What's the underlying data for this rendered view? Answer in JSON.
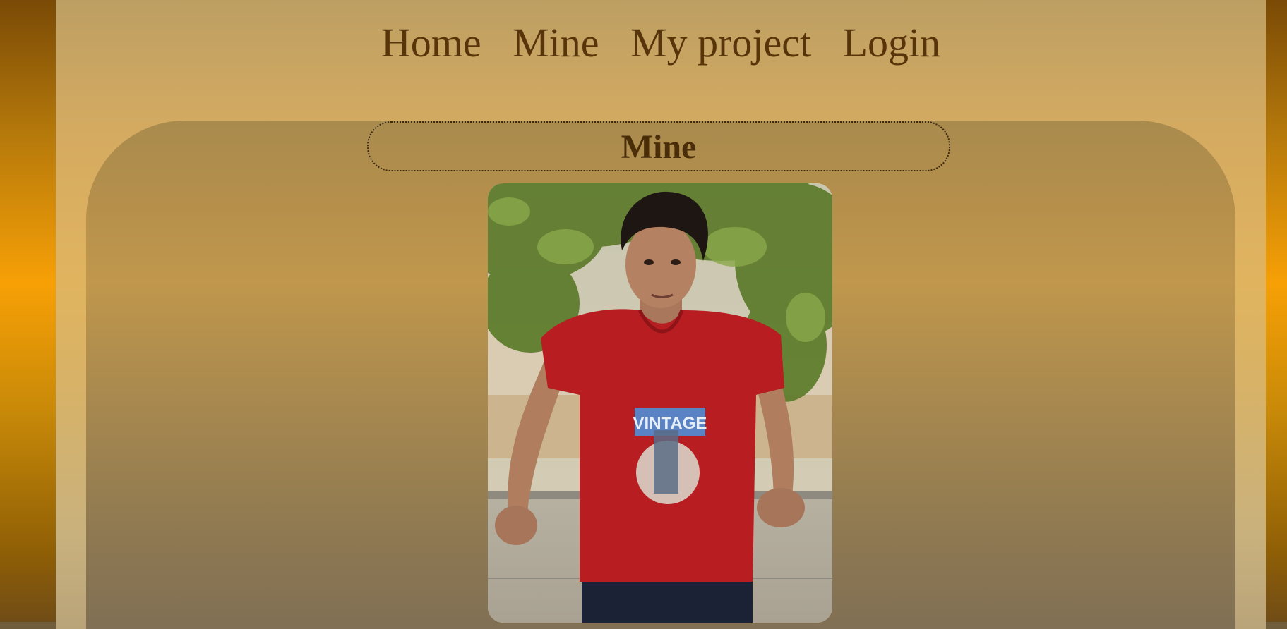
{
  "nav": {
    "items": [
      {
        "label": "Home"
      },
      {
        "label": "Mine"
      },
      {
        "label": "My project"
      },
      {
        "label": "Login"
      }
    ]
  },
  "main": {
    "title": "Mine",
    "photo": {
      "subject": "portrait of a young man in a red t-shirt leaning on a concrete wall under a tree",
      "shirt_print_text": "VINTAGE"
    }
  },
  "colors": {
    "nav_text": "#58340b",
    "title_text": "#4a2e0a",
    "side_gradient_peak": "#f7a006",
    "page_bg": "#d4aa61",
    "content_bg": "#b58f4b"
  }
}
